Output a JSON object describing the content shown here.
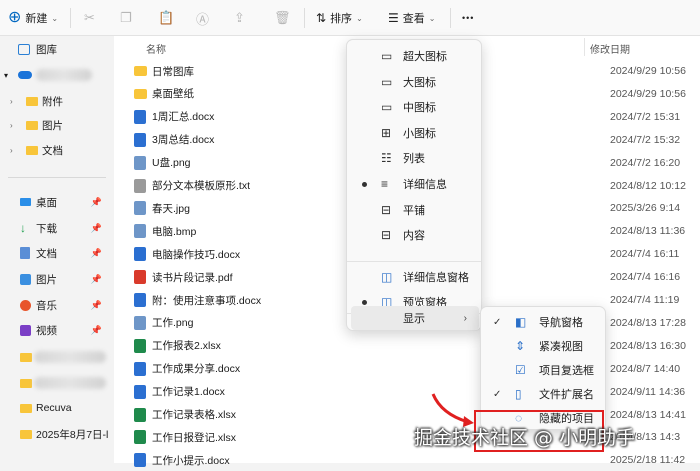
{
  "toolbar": {
    "new_label": "新建",
    "sort_label": "排序",
    "view_label": "查看",
    "more_label": "•••"
  },
  "sidebar": {
    "gallery": "图库",
    "onedrive_children": [
      "附件",
      "图片",
      "文档"
    ],
    "quick": [
      {
        "label": "桌面",
        "icon": "desktop-icon"
      },
      {
        "label": "下载",
        "icon": "download-icon"
      },
      {
        "label": "文档",
        "icon": "document-icon"
      },
      {
        "label": "图片",
        "icon": "picture-icon"
      },
      {
        "label": "音乐",
        "icon": "music-icon"
      },
      {
        "label": "视频",
        "icon": "video-icon"
      }
    ],
    "recuva": "Recuva",
    "dated_folder": "2025年8月7日-l"
  },
  "main": {
    "col_name": "名称",
    "col_date": "修改日期",
    "files": [
      {
        "name": "日常图库",
        "date": "2024/9/29 10:56",
        "type": "folder"
      },
      {
        "name": "桌面壁纸",
        "date": "2024/9/29 10:56",
        "type": "folder"
      },
      {
        "name": "1周汇总.docx",
        "date": "2024/7/2 15:31",
        "type": "docx"
      },
      {
        "name": "3周总结.docx",
        "date": "2024/7/2 15:32",
        "type": "docx"
      },
      {
        "name": "U盘.png",
        "date": "2024/7/2 16:20",
        "type": "png"
      },
      {
        "name": "部分文本模板原形.txt",
        "date": "2024/8/12 10:12",
        "type": "txt"
      },
      {
        "name": "春天.jpg",
        "date": "2025/3/26 9:14",
        "type": "jpg"
      },
      {
        "name": "电脑.bmp",
        "date": "2024/8/13 11:36",
        "type": "bmp"
      },
      {
        "name": "电脑操作技巧.docx",
        "date": "2024/7/4 16:11",
        "type": "docx"
      },
      {
        "name": "读书片段记录.pdf",
        "date": "2024/7/4 16:16",
        "type": "pdf"
      },
      {
        "name": "附：使用注意事项.docx",
        "date": "2024/7/4 11:19",
        "type": "docx"
      },
      {
        "name": "工作.png",
        "date": "2024/8/13 17:28",
        "type": "png"
      },
      {
        "name": "工作报表2.xlsx",
        "date": "2024/8/13 16:30",
        "type": "xlsx"
      },
      {
        "name": "工作成果分享.docx",
        "date": "2024/8/7 14:40",
        "type": "docx"
      },
      {
        "name": "工作记录1.docx",
        "date": "2024/9/11 14:36",
        "type": "docx"
      },
      {
        "name": "工作记录表格.xlsx",
        "date": "2024/8/13 14:41",
        "type": "xlsx"
      },
      {
        "name": "工作日报登记.xlsx",
        "date": "2024/8/13 14:3",
        "type": "xlsx"
      },
      {
        "name": "工作小提示.docx",
        "date": "2025/2/18 11:42",
        "type": "docx"
      }
    ]
  },
  "view_menu": {
    "items": [
      {
        "label": "超大图标",
        "icon": "monitor-icon",
        "selected": false
      },
      {
        "label": "大图标",
        "icon": "monitor-icon",
        "selected": false
      },
      {
        "label": "中图标",
        "icon": "monitor-small-icon",
        "selected": false
      },
      {
        "label": "小图标",
        "icon": "grid-icon",
        "selected": false
      },
      {
        "label": "列表",
        "icon": "list-icon",
        "selected": false
      },
      {
        "label": "详细信息",
        "icon": "details-icon",
        "selected": true
      },
      {
        "label": "平铺",
        "icon": "tiles-icon",
        "selected": false
      },
      {
        "label": "内容",
        "icon": "content-icon",
        "selected": false
      }
    ],
    "pane_items": [
      {
        "label": "详细信息窗格",
        "icon": "details-pane-icon",
        "selected": false
      },
      {
        "label": "预览窗格",
        "icon": "preview-pane-icon",
        "selected": true
      }
    ],
    "show_label": "显示"
  },
  "show_submenu": {
    "items": [
      {
        "label": "导航窗格",
        "checked": true,
        "icon": "nav-pane-icon"
      },
      {
        "label": "紧凑视图",
        "checked": false,
        "icon": "compact-view-icon"
      },
      {
        "label": "项目复选框",
        "checked": false,
        "icon": "checkbox-icon"
      },
      {
        "label": "文件扩展名",
        "checked": true,
        "icon": "file-ext-icon"
      },
      {
        "label": "隐藏的项目",
        "checked": false,
        "icon": "hidden-items-icon"
      }
    ]
  },
  "watermark": "掘金技术社区 @ 小明助手",
  "colors": {
    "accent": "#0067c0",
    "folder": "#f8c53a",
    "highlight": "#e02020"
  }
}
